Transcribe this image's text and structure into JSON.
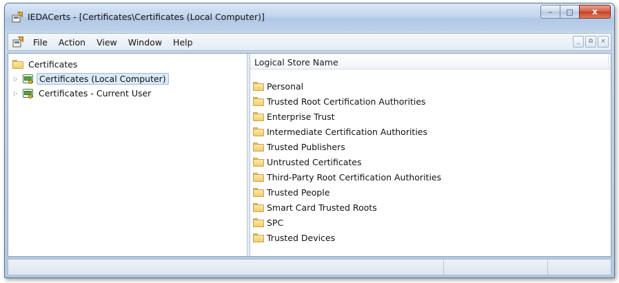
{
  "window": {
    "title": "IEDACerts - [Certificates\\Certificates (Local Computer)]",
    "app_icon": "mmc-console-icon",
    "caption_buttons": {
      "minimize": "–",
      "maximize": "□",
      "close": "x"
    }
  },
  "menubar": {
    "items": [
      "File",
      "Action",
      "View",
      "Window",
      "Help"
    ],
    "mdi_buttons": {
      "minimize": "_",
      "restore": "⧉",
      "close": "×"
    }
  },
  "tree": {
    "root": {
      "label": "Certificates",
      "icon": "folder-icon"
    },
    "children": [
      {
        "label": "Certificates (Local Computer)",
        "icon": "certificate-store-icon",
        "selected": true
      },
      {
        "label": "Certificates - Current User",
        "icon": "certificate-store-icon",
        "selected": false
      }
    ]
  },
  "list": {
    "column_header": "Logical Store Name",
    "items": [
      "Personal",
      "Trusted Root Certification Authorities",
      "Enterprise Trust",
      "Intermediate Certification Authorities",
      "Trusted Publishers",
      "Untrusted Certificates",
      "Third-Party Root Certification Authorities",
      "Trusted People",
      "Smart Card Trusted Roots",
      "SPC",
      "Trusted Devices"
    ]
  },
  "statusbar": {
    "cells": [
      "",
      "",
      ""
    ]
  },
  "colors": {
    "title_gradient_top": "#dbe8f6",
    "title_gradient_bottom": "#bcd1ea",
    "close_button": "#c33f25",
    "selection_background": "#dbe9f8",
    "selection_border": "#99bde4",
    "folder": "#f1cf6f"
  }
}
